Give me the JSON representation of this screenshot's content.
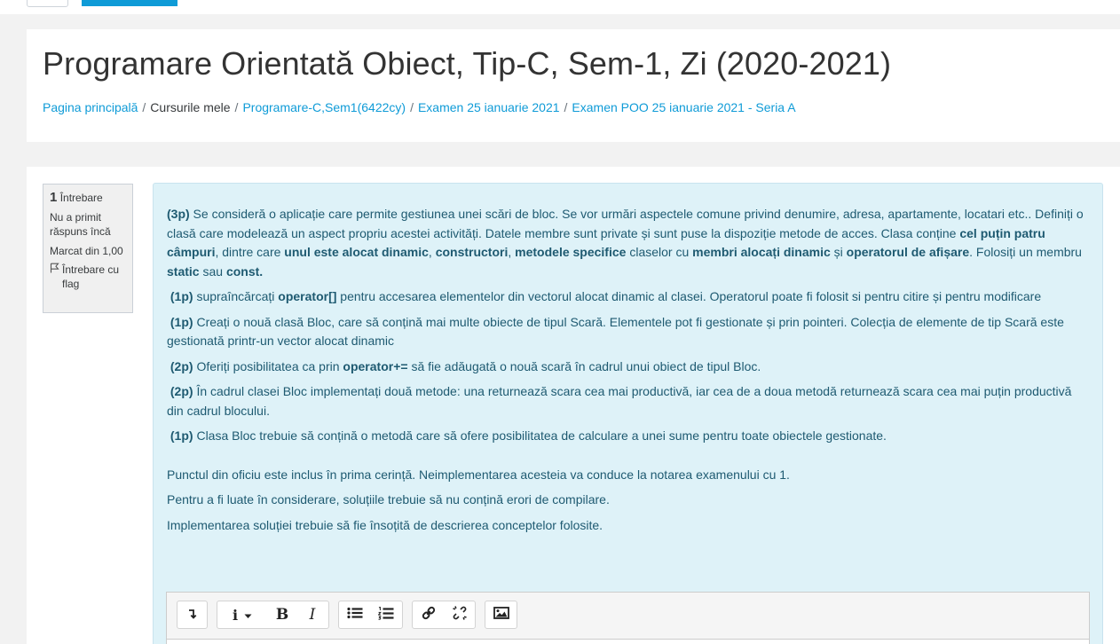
{
  "page": {
    "title": "Programare Orientată Obiect, Tip-C, Sem-1, Zi (2020-2021)"
  },
  "breadcrumb": [
    {
      "label": "Pagina principală",
      "link": true
    },
    {
      "label": "Cursurile mele",
      "link": false
    },
    {
      "label": "Programare-C,Sem1(6422cy)",
      "link": true
    },
    {
      "label": "Examen 25 ianuarie 2021",
      "link": true
    },
    {
      "label": "Examen POO 25 ianuarie 2021 - Seria A",
      "link": true
    }
  ],
  "question_info": {
    "number": "1",
    "number_label": "Întrebare",
    "status": "Nu a primit răspuns încă",
    "marks": "Marcat din 1,00",
    "flag_label": "Întrebare cu flag"
  },
  "question": {
    "p1_points": "(3p)",
    "p1_a": " Se consideră o aplicație care permite gestiunea unei scări de bloc. Se vor urmări aspectele comune privind denumire, adresa, apartamente, locatari etc.. Definiți o clasă care modelează un aspect propriu acestei activități. Datele membre sunt private și sunt puse la dispoziție metode de acces. Clasa conține ",
    "p1_b1": "cel puțin patru câmpuri",
    "p1_c": ", dintre care ",
    "p1_b2": "unul este alocat dinamic",
    "p1_d": ", ",
    "p1_b3": "constructori",
    "p1_e": ", ",
    "p1_b4": "metodele specifice",
    "p1_f": " claselor cu ",
    "p1_b5": "membri alocați dinamic",
    "p1_g": " și ",
    "p1_b6": "operatorul de afișare",
    "p1_h": ". Folosiți un membru ",
    "p1_b7": "static",
    "p1_i": " sau ",
    "p1_b8": "const.",
    "p2_points": "(1p)",
    "p2_a": " supraîncărcați ",
    "p2_b": "operator[]",
    "p2_c": " pentru accesarea elementelor din vectorul alocat dinamic al clasei. Operatorul poate fi folosit si pentru citire și pentru modificare",
    "p3_points": "(1p)",
    "p3_a": " Creați o nouă clasă Bloc, care să conțină mai multe obiecte de tipul Scară. Elementele pot fi gestionate și prin pointeri. Colecția de elemente de tip Scară este gestionată printr-un vector alocat dinamic",
    "p4_points": "(2p)",
    "p4_a": " Oferiți posibilitatea ca prin ",
    "p4_b": "operator+=",
    "p4_c": " să fie adăugată o nouă scară în cadrul unui obiect de tipul Bloc.",
    "p5_points": "(2p)",
    "p5_a": " În cadrul clasei Bloc implementați două metode: una returnează scara cea mai productivă, iar cea de a doua metodă returnează scara cea mai puțin productivă din cadrul blocului.",
    "p6_points": "(1p)",
    "p6_a": " Clasa Bloc trebuie să conțină o metodă care să ofere posibilitatea de calculare a unei sume pentru toate obiectele gestionate.",
    "note1": "Punctul din oficiu este inclus în prima cerință. Neimplementarea acesteia va conduce la notarea examenului cu 1.",
    "note2": "Pentru a fi luate în considerare, soluțiile trebuie să nu conțină erori de compilare.",
    "note3": "Implementarea soluției trebuie să fie însoțită de descrierea conceptelor folosite."
  },
  "toolbar": {
    "buttons": [
      "toggle-toolbar",
      "info-menu",
      "bold",
      "italic",
      "bullet-list",
      "numbered-list",
      "link",
      "unlink",
      "image"
    ],
    "bold_glyph": "B",
    "italic_glyph": "I",
    "info_glyph": "i"
  },
  "colors": {
    "link": "#0f9bd7",
    "question_bg": "#def2f8",
    "question_text": "#1e5a71"
  }
}
